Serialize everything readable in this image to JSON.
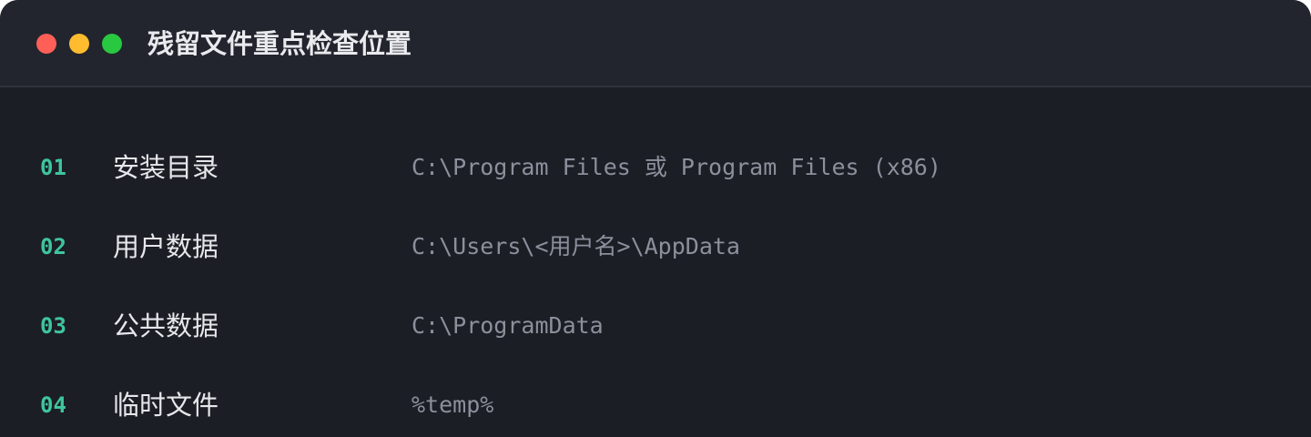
{
  "window": {
    "title": "残留文件重点检查位置",
    "controls": [
      "close",
      "minimize",
      "zoom"
    ]
  },
  "colors": {
    "background": "#1c1e25",
    "titlebar": "#22252d",
    "accent_number": "#3ec59d",
    "label_text": "#e6e7eb",
    "path_text": "#8b909c",
    "close": "#fe5f57",
    "minimize": "#febc2e",
    "zoom": "#28c840"
  },
  "rows": [
    {
      "num": "01",
      "label": "安装目录",
      "path": "C:\\Program Files 或 Program Files (x86)"
    },
    {
      "num": "02",
      "label": "用户数据",
      "path": "C:\\Users\\<用户名>\\AppData"
    },
    {
      "num": "03",
      "label": "公共数据",
      "path": "C:\\ProgramData"
    },
    {
      "num": "04",
      "label": "临时文件",
      "path": "%temp%"
    }
  ]
}
